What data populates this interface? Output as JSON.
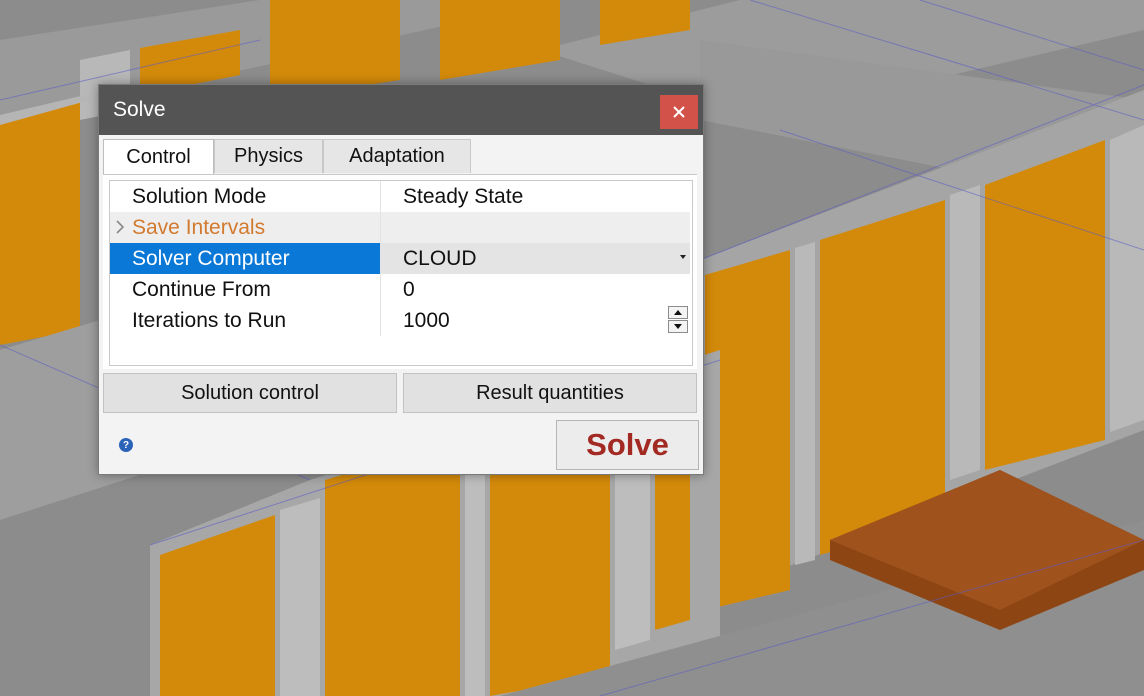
{
  "dialog": {
    "title": "Solve",
    "close_icon": "close-icon",
    "tabs": [
      {
        "label": "Control",
        "active": true
      },
      {
        "label": "Physics",
        "active": false
      },
      {
        "label": "Adaptation",
        "active": false
      }
    ],
    "properties": [
      {
        "name": "Solution Mode",
        "value": "Steady State"
      },
      {
        "name": "Save Intervals",
        "value": ""
      },
      {
        "name": "Solver Computer",
        "value": "CLOUD"
      },
      {
        "name": "Continue From",
        "value": "0"
      },
      {
        "name": "Iterations to Run",
        "value": "1000"
      }
    ],
    "buttons": {
      "solution_control": "Solution control",
      "result_quantities": "Result quantities",
      "solve": "Solve"
    },
    "help_icon": "help-icon"
  },
  "colors": {
    "titlebar": "#555455",
    "close": "#d2524a",
    "selection": "#0a78d7",
    "solve_text": "#a32a22",
    "save_intervals_text": "#d27a2e",
    "panel_orange": "#d38a0a",
    "floor_gray": "#8a8a8a"
  }
}
